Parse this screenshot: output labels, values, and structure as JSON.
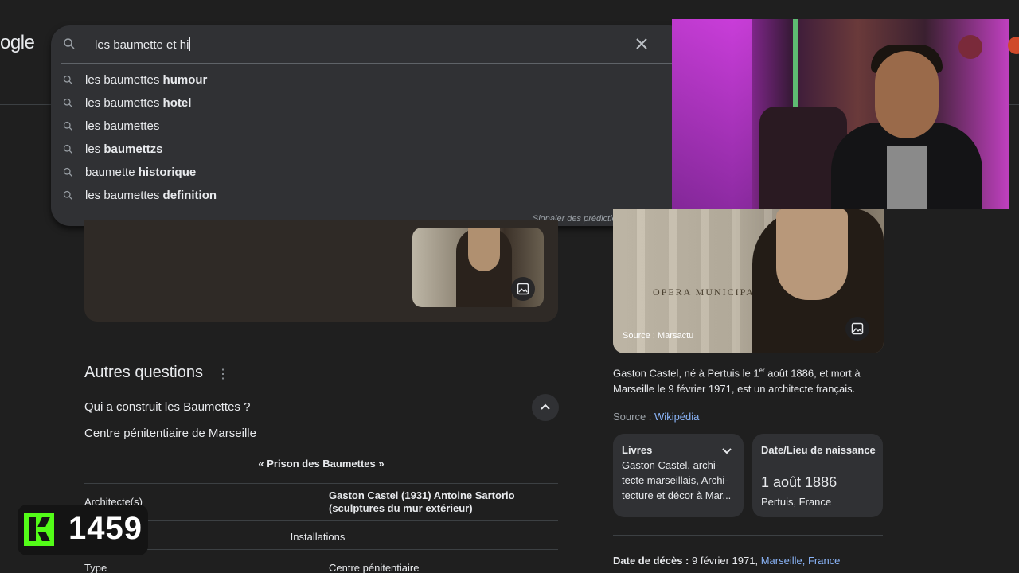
{
  "header": {
    "logo_text": "ogle"
  },
  "search": {
    "query": "les baumette et hi",
    "report_label": "Signaler des prédictions inappropriées",
    "suggestions": [
      {
        "prefix": "les baumettes",
        "bold": " humour"
      },
      {
        "prefix": "les baumettes",
        "bold": " hotel"
      },
      {
        "prefix": "les baumettes",
        "bold": ""
      },
      {
        "prefix": "les ",
        "bold": "baumettzs"
      },
      {
        "prefix": "baumette ",
        "bold": "historique"
      },
      {
        "prefix": "les baumettes",
        "bold": " definition"
      }
    ]
  },
  "people_also_ask": {
    "title": "Autres questions",
    "question": "Qui a construit les Baumettes ?",
    "answer": "Centre pénitentiaire de Marseille",
    "infobox_title": "« Prison des Baumettes »",
    "rows": [
      {
        "label": "Architecte(s)",
        "value": "Gaston Castel (1931) Antoine Sartorio (sculptures du mur extérieur)"
      },
      {
        "center": "Installations"
      },
      {
        "label": "Type",
        "value": "Centre pénitentiaire"
      }
    ]
  },
  "kick_overlay": {
    "count": "1459"
  },
  "knowledge_panel": {
    "image_source": "Source : Marsactu",
    "image_sign": "OPERA MUNICIPAL",
    "description_part1": "Gaston Castel, né à Pertuis le 1",
    "description_sup": "er",
    "description_part2": " août 1886, et mort à Marseille le 9 février 1971, est un architecte français.",
    "source_label": "Source : ",
    "source_link": "Wikipédia",
    "card_books": {
      "title": "Livres",
      "text": "Gaston Castel, archi-tecte marseillais, Archi-tecture et décor à Mar..."
    },
    "card_birth": {
      "title": "Date/Lieu de naissance",
      "date": "1 août 1886",
      "place": "Pertuis, France"
    },
    "death_label": "Date de décès :",
    "death_date": " 9 février 1971, ",
    "death_place": "Marseille, France"
  },
  "colors": {
    "background": "#1f1f1f",
    "surface": "#303134",
    "link": "#8ab4f8",
    "kick_green": "#53fc18"
  }
}
